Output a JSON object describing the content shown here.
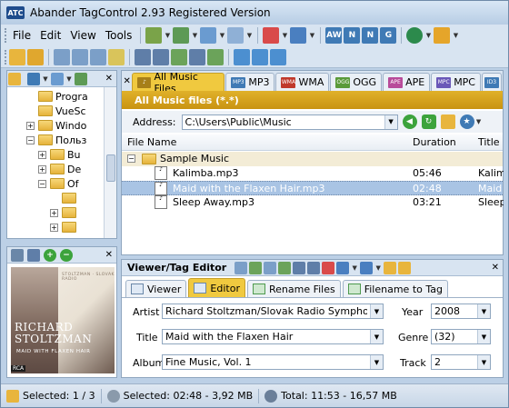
{
  "window": {
    "title": "Abander TagControl 2.93 Registered Version",
    "app_icon_text": "ATC"
  },
  "menu": [
    "File",
    "Edit",
    "View",
    "Tools"
  ],
  "toolbar_format_labels": [
    "AW",
    "N",
    "N",
    "G"
  ],
  "left_tree": {
    "items": [
      {
        "label": "Progra",
        "indent": 1
      },
      {
        "label": "VueSc",
        "indent": 1
      },
      {
        "label": "Windo",
        "indent": 1
      },
      {
        "label": "Польз",
        "indent": 1
      },
      {
        "label": "Bu",
        "indent": 2
      },
      {
        "label": "De",
        "indent": 2
      },
      {
        "label": "Of",
        "indent": 2
      },
      {
        "label": "",
        "indent": 3
      },
      {
        "label": "",
        "indent": 3
      },
      {
        "label": "",
        "indent": 3
      }
    ]
  },
  "cover": {
    "artist_line1": "RICHARD",
    "artist_line2": "STOLTZMAN",
    "subtitle": "MAID WITH FLAXEN HAIR",
    "label_top": "STOLTZMAN · SLOVAK RADIO",
    "stamp": "RCA"
  },
  "file_tabs": [
    {
      "label": "All Music Files",
      "active": true,
      "icon": "music-note"
    },
    {
      "label": "MP3",
      "active": false,
      "icon": "mp3"
    },
    {
      "label": "WMA",
      "active": false,
      "icon": "wma"
    },
    {
      "label": "OGG",
      "active": false,
      "icon": "ogg"
    },
    {
      "label": "APE",
      "active": false,
      "icon": "ape"
    },
    {
      "label": "MPC",
      "active": false,
      "icon": "mpc"
    }
  ],
  "banner": "All Music files (*.*)",
  "address": {
    "label": "Address:",
    "value": "C:\\Users\\Public\\Music"
  },
  "grid": {
    "columns": [
      "File Name",
      "Duration",
      "Title"
    ],
    "group": "Sample Music",
    "rows": [
      {
        "name": "Kalimba.mp3",
        "duration": "05:46",
        "title": "Kalimb",
        "selected": false
      },
      {
        "name": "Maid with the Flaxen Hair.mp3",
        "duration": "02:48",
        "title": "Maid w",
        "selected": true
      },
      {
        "name": "Sleep Away.mp3",
        "duration": "03:21",
        "title": "Sleep",
        "selected": false
      }
    ]
  },
  "editor": {
    "title": "Viewer/Tag Editor",
    "tabs": [
      {
        "label": "Viewer",
        "active": false
      },
      {
        "label": "Editor",
        "active": true
      },
      {
        "label": "Rename Files",
        "active": false
      },
      {
        "label": "Filename to Tag",
        "active": false
      }
    ],
    "fields": {
      "artist_label": "Artist",
      "artist": "Richard Stoltzman/Slovak Radio Symphony Orchestr",
      "title_label": "Title",
      "title": "Maid with the Flaxen Hair",
      "album_label": "Album",
      "album": "Fine Music, Vol. 1",
      "year_label": "Year",
      "year": "2008",
      "genre_label": "Genre",
      "genre": "(32)",
      "track_label": "Track",
      "track": "2"
    }
  },
  "status": {
    "selected_count": "Selected: 1 / 3",
    "selected_size": "Selected: 02:48 - 3,92 MB",
    "total": "Total: 11:53 - 16,57 MB"
  },
  "colors": {
    "accent": "#f0c93f",
    "banner": "#d5a21d",
    "frame": "#bcd0e6"
  }
}
